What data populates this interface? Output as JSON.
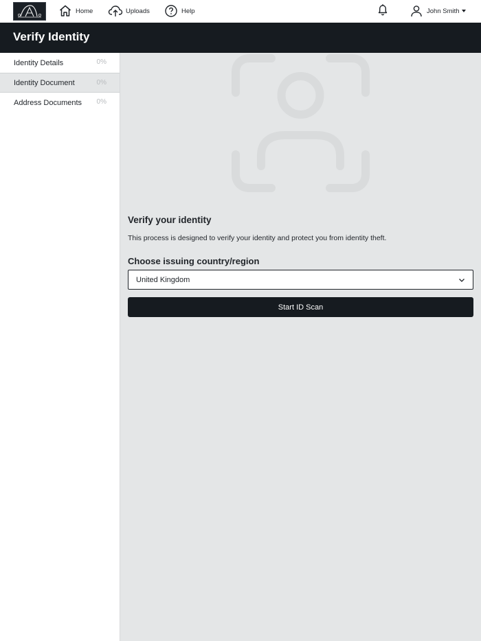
{
  "nav": {
    "home": "Home",
    "uploads": "Uploads",
    "help": "Help",
    "user_name": "John Smith"
  },
  "header": {
    "title": "Verify Identity"
  },
  "sidebar": {
    "items": [
      {
        "label": "Identity Details",
        "progress": "0%"
      },
      {
        "label": "Identity Document",
        "progress": "0%",
        "active": true
      },
      {
        "label": "Address Documents",
        "progress": "0%"
      }
    ]
  },
  "main": {
    "title": "Verify your identity",
    "description": "This process is designed to verify your identity and protect you from identity theft.",
    "country_label": "Choose issuing country/region",
    "country_value": "United Kingdom",
    "start_button": "Start ID Scan"
  },
  "icons": {
    "home": "home-icon",
    "uploads": "cloud-upload-icon",
    "help": "help-circle-icon",
    "notifications": "bell-icon",
    "user": "user-icon",
    "illustration": "face-scan-icon"
  },
  "colors": {
    "dark": "#161b20",
    "main_bg": "#e4e6e7",
    "muted": "#b8bbbe"
  }
}
